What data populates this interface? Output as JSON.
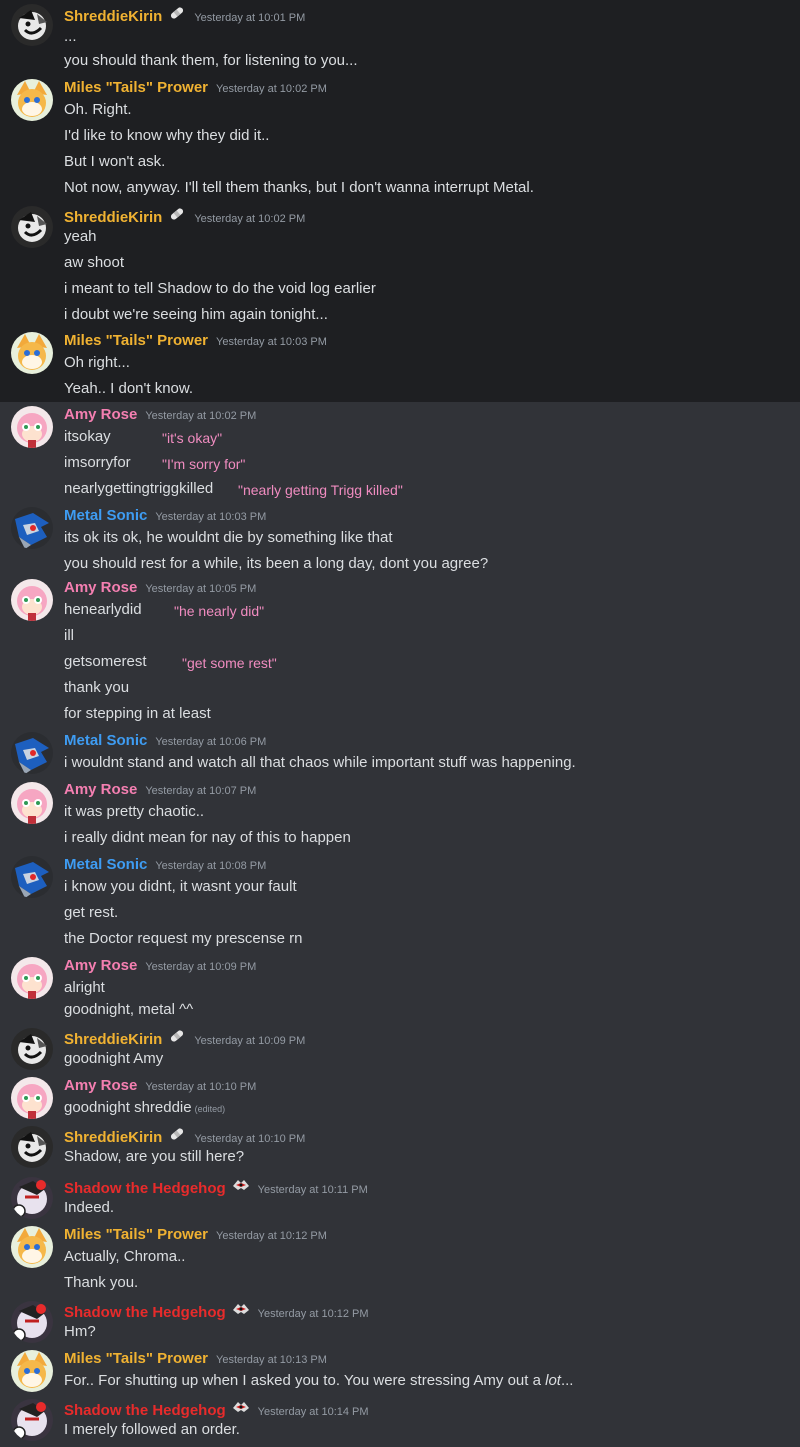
{
  "colors": {
    "shreddie": "#f0b232",
    "tails": "#f0b232",
    "amy": "#f47fb1",
    "metal": "#3e9cf2",
    "shadow": "#e82b2b",
    "text": "#dbdee1",
    "timestamp": "#949ba4",
    "note": "#f08cc0"
  },
  "messages": [
    {
      "user": "ShreddieKirin",
      "avatar": "shreddie-avatar",
      "badge": "bandage-icon",
      "time": "Yesterday at 10:01 PM",
      "lines": [
        "...",
        "you should thank them, for listening to you..."
      ]
    },
    {
      "user": "Miles \"Tails\" Prower",
      "avatar": "tails-avatar",
      "time": "Yesterday at 10:02 PM",
      "lines": [
        "Oh. Right.",
        "I'd like to know why they did it..",
        "But I won't ask.",
        "Not now, anyway. I'll tell them thanks, but I don't wanna interrupt Metal."
      ]
    },
    {
      "user": "ShreddieKirin",
      "avatar": "shreddie-avatar",
      "badge": "bandage-icon",
      "time": "Yesterday at 10:02 PM",
      "lines": [
        "yeah",
        "aw shoot",
        "i meant to tell Shadow to do the void log earlier",
        "i doubt we're seeing him again tonight..."
      ]
    },
    {
      "user": "Miles \"Tails\" Prower",
      "avatar": "tails-avatar",
      "time": "Yesterday at 10:03 PM",
      "lines": [
        "Oh right...",
        "Yeah.. I don't know."
      ]
    },
    {
      "user": "Amy Rose",
      "avatar": "amy-avatar",
      "time": "Yesterday at 10:02 PM",
      "lines": [
        "itsokay",
        "imsorryfor",
        "nearlygettingtriggkilled"
      ],
      "notes": [
        "\"it's okay\"",
        "\"I'm sorry for\"",
        "\"nearly getting Trigg killed\""
      ]
    },
    {
      "user": "Metal Sonic",
      "avatar": "metal-avatar",
      "time": "Yesterday at 10:03 PM",
      "lines": [
        "its ok its ok, he wouldnt die by something like that",
        "you should rest for a while, its been a long day, dont you agree?"
      ]
    },
    {
      "user": "Amy Rose",
      "avatar": "amy-avatar",
      "time": "Yesterday at 10:05 PM",
      "lines": [
        "henearlydid",
        "ill",
        "getsomerest",
        "thank you",
        "for stepping in at least"
      ],
      "notes": [
        "\"he nearly did\"",
        "",
        "\"get some rest\""
      ]
    },
    {
      "user": "Metal Sonic",
      "avatar": "metal-avatar",
      "time": "Yesterday at 10:06 PM",
      "lines": [
        "i wouldnt stand and watch all that chaos while important stuff was happening."
      ]
    },
    {
      "user": "Amy Rose",
      "avatar": "amy-avatar",
      "time": "Yesterday at 10:07 PM",
      "lines": [
        "it was pretty chaotic..",
        "i really didnt mean for nay of this to happen"
      ]
    },
    {
      "user": "Metal Sonic",
      "avatar": "metal-avatar",
      "time": "Yesterday at 10:08 PM",
      "lines": [
        "i know you didnt, it wasnt your fault",
        "get rest.",
        "the Doctor request my prescense rn"
      ]
    },
    {
      "user": "Amy Rose",
      "avatar": "amy-avatar",
      "time": "Yesterday at 10:09 PM",
      "lines": [
        "alright",
        "goodnight, metal ^^"
      ]
    },
    {
      "user": "ShreddieKirin",
      "avatar": "shreddie-avatar",
      "badge": "bandage-icon",
      "time": "Yesterday at 10:09 PM",
      "lines": [
        "goodnight Amy"
      ]
    },
    {
      "user": "Amy Rose",
      "avatar": "amy-avatar",
      "time": "Yesterday at 10:10 PM",
      "lines": [
        "goodnight shreddie"
      ],
      "edited": "(edited)"
    },
    {
      "user": "ShreddieKirin",
      "avatar": "shreddie-avatar",
      "badge": "bandage-icon",
      "time": "Yesterday at 10:10 PM",
      "lines": [
        "Shadow, are you still here?"
      ]
    },
    {
      "user": "Shadow the Hedgehog",
      "avatar": "shadow-avatar",
      "badge": "shadow-emblem-icon",
      "time": "Yesterday at 10:11 PM",
      "lines": [
        "Indeed."
      ]
    },
    {
      "user": "Miles \"Tails\" Prower",
      "avatar": "tails-avatar",
      "time": "Yesterday at 10:12 PM",
      "lines": [
        "Actually, Chroma..",
        "Thank you."
      ]
    },
    {
      "user": "Shadow the Hedgehog",
      "avatar": "shadow-avatar",
      "badge": "shadow-emblem-icon",
      "time": "Yesterday at 10:12 PM",
      "lines": [
        "Hm?"
      ]
    },
    {
      "user": "Miles \"Tails\" Prower",
      "avatar": "tails-avatar",
      "time": "Yesterday at 10:13 PM",
      "lines": [
        "For.. For shutting up when I asked you to. You were stressing Amy out a ",
        "lot",
        "..."
      ]
    },
    {
      "user": "Shadow the Hedgehog",
      "avatar": "shadow-avatar",
      "badge": "shadow-emblem-icon",
      "time": "Yesterday at 10:14 PM",
      "lines": [
        "I merely followed an order."
      ]
    }
  ]
}
